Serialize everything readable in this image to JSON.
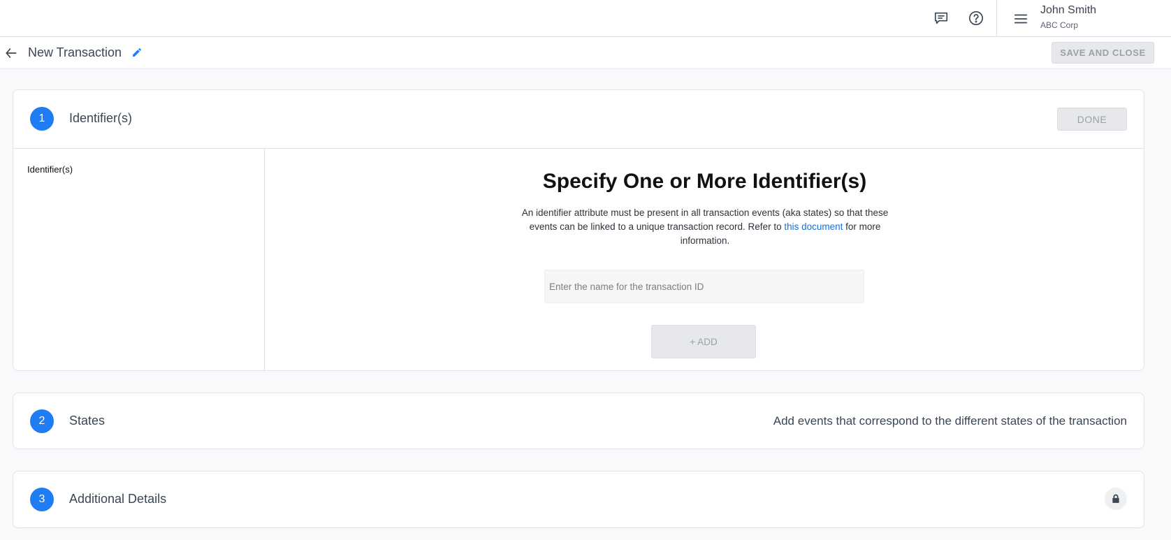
{
  "header": {
    "user_name": "John Smith",
    "user_org": "ABC Corp",
    "icons": [
      "chat-icon",
      "help-icon",
      "menu-icon"
    ]
  },
  "titlebar": {
    "title": "New Transaction",
    "save_close_label": "SAVE AND CLOSE"
  },
  "steps": [
    {
      "number": "1",
      "title": "Identifier(s)",
      "done_label": "DONE",
      "sidebar_items": [
        "Identifier(s)"
      ],
      "heading": "Specify One or More Identifier(s)",
      "description_before": "An identifier attribute must be present in all transaction events (aka states) so that these events can be linked to a unique transaction record. Refer to ",
      "description_link": "this document",
      "description_after": " for more information.",
      "input_placeholder": "Enter the name for the transaction ID",
      "input_value": "",
      "add_label": "+ ADD"
    },
    {
      "number": "2",
      "title": "States",
      "hint": "Add events that correspond to the different states of the transaction"
    },
    {
      "number": "3",
      "title": "Additional Details",
      "locked": true
    }
  ],
  "colors": {
    "accent": "#1f7cf2",
    "link": "#1a6fd6",
    "disabled_button": "#e6e8eb"
  }
}
